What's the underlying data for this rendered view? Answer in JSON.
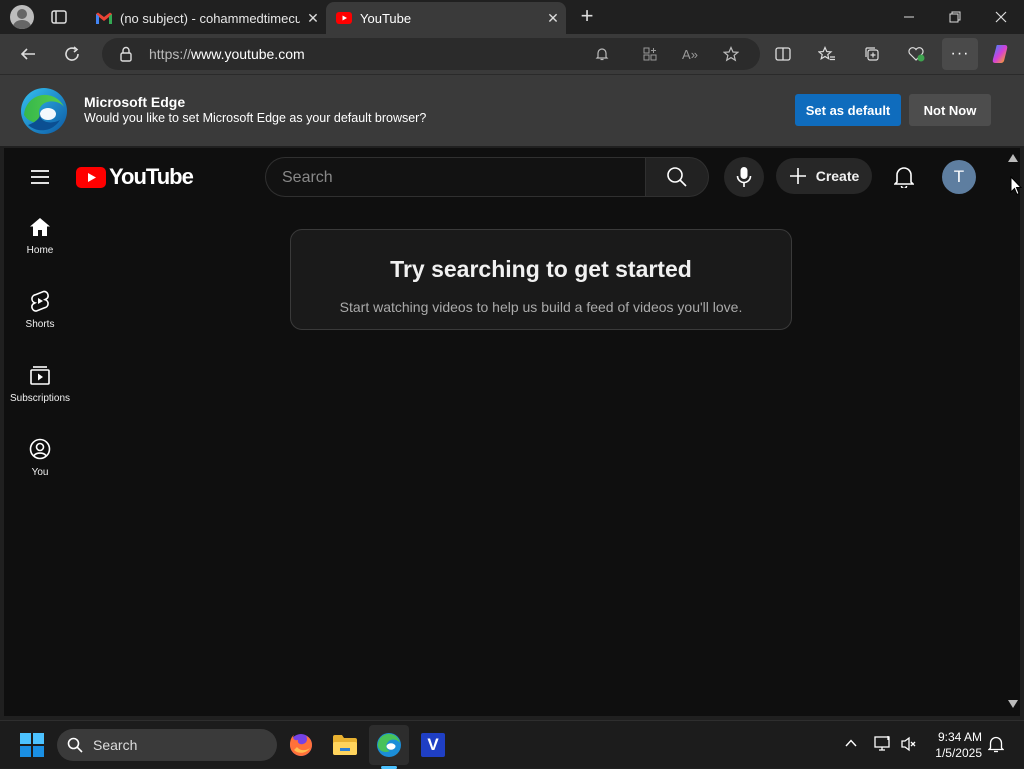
{
  "browser": {
    "tabs": [
      {
        "title": "(no subject) - cohammedtimecub",
        "favicon": "gmail-icon"
      },
      {
        "title": "YouTube",
        "favicon": "youtube-icon",
        "active": true
      }
    ],
    "url_scheme": "https://",
    "url_host": "www.youtube.com",
    "window_controls": [
      "minimize",
      "restore",
      "close"
    ]
  },
  "infobar": {
    "title": "Microsoft Edge",
    "message": "Would you like to set Microsoft Edge as your default browser?",
    "primary_button": "Set as default",
    "secondary_button": "Not Now"
  },
  "youtube": {
    "logo_text": "YouTube",
    "search_placeholder": "Search",
    "create_label": "Create",
    "avatar_initial": "T",
    "sidebar": [
      {
        "label": "Home",
        "icon": "home-icon"
      },
      {
        "label": "Shorts",
        "icon": "shorts-icon"
      },
      {
        "label": "Subscriptions",
        "icon": "subscriptions-icon"
      },
      {
        "label": "You",
        "icon": "you-icon"
      }
    ],
    "prompt": {
      "title": "Try searching to get started",
      "subtitle": "Start watching videos to help us build a feed of videos you'll love."
    }
  },
  "taskbar": {
    "search_label": "Search",
    "time": "9:34 AM",
    "date": "1/5/2025"
  },
  "colors": {
    "yt_red": "#ff0000",
    "edge_blue": "#0f6cbd",
    "yt_bg": "#0f0f0f"
  }
}
